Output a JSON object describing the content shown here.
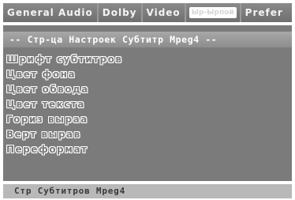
{
  "tabs": [
    {
      "label": "General Audio",
      "active": false
    },
    {
      "label": "Dolby",
      "active": false
    },
    {
      "label": "Video",
      "active": false
    },
    {
      "label": "Ыр-Ырпой",
      "active": true
    },
    {
      "label": "Prefer",
      "active": false
    }
  ],
  "panel": {
    "header": "-- Стр-ца Настроек Субтитр Mpeg4 --",
    "items": [
      "Шрифт субтитров",
      "Цвет фона",
      "Цвет обвода",
      "Цвет текста",
      "Гориз выраа",
      "Верт вырав",
      "Переформат"
    ]
  },
  "status": {
    "text": "Стр Субтитров Mpeg4"
  },
  "colors": {
    "tabbar": "#7d7d7d",
    "panel": "#7b7b7b",
    "header": "#9c9c9c",
    "status": "#b8b8b8"
  }
}
